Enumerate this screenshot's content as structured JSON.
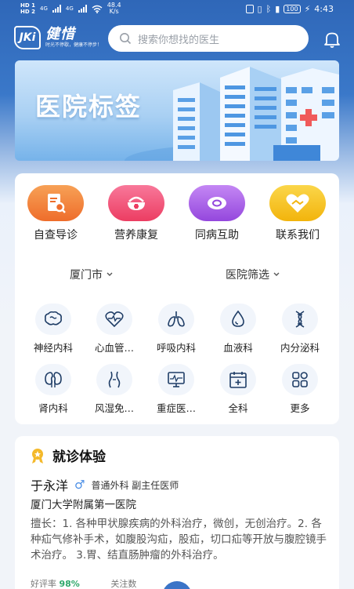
{
  "status_bar": {
    "sim1": "HD 1",
    "sim2": "HD 2",
    "net1": "4G",
    "net2": "4G",
    "speed": "48.4",
    "speed_unit": "K/s",
    "battery": "100",
    "time": "4:43"
  },
  "header": {
    "logo_mark": "JKi",
    "app_name": "健惜",
    "slogan": "时光不停歇，健康不停步！",
    "search_placeholder": "搜索你想找的医生"
  },
  "banner": {
    "title": "医院标签"
  },
  "quick_actions": [
    {
      "label": "自查导诊",
      "icon": "report-search-icon",
      "color": "#f0823a"
    },
    {
      "label": "营养康复",
      "icon": "bowl-icon",
      "color": "#f04e72"
    },
    {
      "label": "同病互助",
      "icon": "pill-icon",
      "color": "#a75fe3"
    },
    {
      "label": "联系我们",
      "icon": "heart-handshake-icon",
      "color": "#f5c21d"
    }
  ],
  "filters": {
    "city": "厦门市",
    "hospital": "医院筛选"
  },
  "departments": [
    {
      "label": "神经内科",
      "icon": "brain-icon"
    },
    {
      "label": "心血管…",
      "icon": "heart-pulse-icon"
    },
    {
      "label": "呼吸内科",
      "icon": "lungs-icon"
    },
    {
      "label": "血液科",
      "icon": "blood-drop-icon"
    },
    {
      "label": "内分泌科",
      "icon": "dna-icon"
    },
    {
      "label": "肾内科",
      "icon": "kidney-icon"
    },
    {
      "label": "风湿免…",
      "icon": "joint-icon"
    },
    {
      "label": "重症医…",
      "icon": "monitor-icon"
    },
    {
      "label": "全科",
      "icon": "calendar-plus-icon"
    },
    {
      "label": "更多",
      "icon": "grid-more-icon"
    }
  ],
  "section": {
    "title": "就诊体验"
  },
  "doctor": {
    "name": "于永洋",
    "gender_symbol": "♂",
    "titles": "普通外科  副主任医师",
    "hospital": "厦门大学附属第一医院",
    "skill": "擅长：1. 各种甲状腺疾病的外科治疗，微创，无创治疗。2. 各种疝气修补手术，如腹股沟疝，股疝，切口疝等开放与腹腔镜手术治疗。 3.胃、结直肠肿瘤的外科治疗。",
    "rating_label": "好评率",
    "rating_value": "98%",
    "follow_label": "关注数"
  },
  "colors": {
    "accent": "#3b74c7",
    "header_bg": "#2f67b8"
  }
}
